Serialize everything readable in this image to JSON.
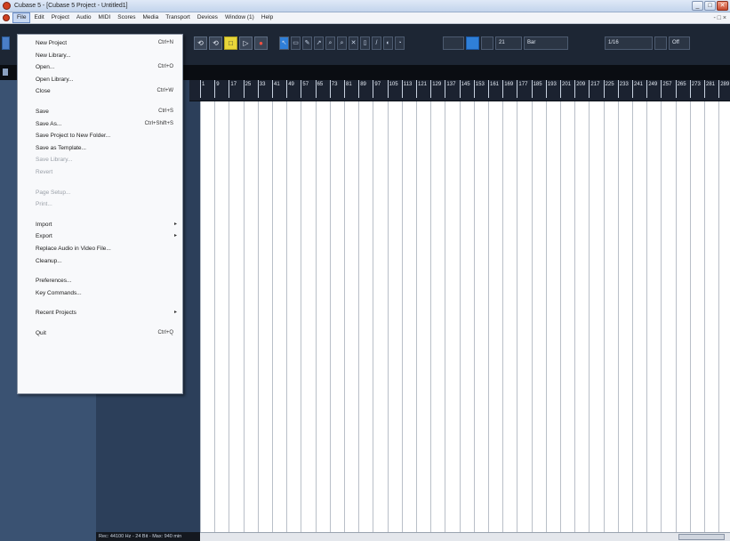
{
  "titlebar": {
    "title": "Cubase 5 - [Cubase 5 Project - Untitled1]",
    "minimize": "_",
    "maximize": "□",
    "close": "✕"
  },
  "menubar": {
    "items": [
      "File",
      "Edit",
      "Project",
      "Audio",
      "MIDI",
      "Scores",
      "Media",
      "Transport",
      "Devices",
      "Window (1)",
      "Help"
    ],
    "right": "- □ ×"
  },
  "toolbar": {
    "transport_buttons": [
      "⟲",
      "⟲",
      "□",
      "▷",
      "●"
    ],
    "tool_icons": [
      "↖",
      "▭",
      "✎",
      "↗",
      "⌕",
      "⌕",
      "✕",
      "▯",
      "/",
      "◐",
      "◔"
    ],
    "quantize_label": "Bar",
    "length_label": "1/16",
    "grid_label": "Off",
    "num_field": "21"
  },
  "ruler": {
    "marks": [
      "1",
      "9",
      "17",
      "25",
      "33",
      "41",
      "49",
      "57",
      "65",
      "73",
      "81",
      "89",
      "97",
      "105",
      "113",
      "121",
      "129",
      "137",
      "145",
      "153",
      "161",
      "169",
      "177",
      "185",
      "193",
      "201",
      "209",
      "217",
      "225",
      "233",
      "241",
      "249",
      "257",
      "265",
      "273",
      "281",
      "289"
    ]
  },
  "file_menu": {
    "items": [
      {
        "label": "New Project",
        "shortcut": "Ctrl+N"
      },
      {
        "label": "New Library..."
      },
      {
        "label": "Open...",
        "shortcut": "Ctrl+O"
      },
      {
        "label": "Open Library..."
      },
      {
        "label": "Close",
        "shortcut": "Ctrl+W"
      },
      {
        "sep": true
      },
      {
        "label": "Save",
        "shortcut": "Ctrl+S"
      },
      {
        "label": "Save As...",
        "shortcut": "Ctrl+Shift+S"
      },
      {
        "label": "Save Project to New Folder..."
      },
      {
        "label": "Save as Template..."
      },
      {
        "label": "Save Library...",
        "disabled": true
      },
      {
        "label": "Revert",
        "disabled": true
      },
      {
        "sep": true
      },
      {
        "label": "Page Setup...",
        "disabled": true
      },
      {
        "label": "Print...",
        "disabled": true
      },
      {
        "sep": true
      },
      {
        "label": "Import",
        "submenu": true
      },
      {
        "label": "Export",
        "submenu": true
      },
      {
        "label": "Replace Audio in Video File..."
      },
      {
        "label": "Cleanup..."
      },
      {
        "sep": true
      },
      {
        "label": "Preferences..."
      },
      {
        "label": "Key Commands..."
      },
      {
        "sep": true
      },
      {
        "label": "Recent Projects",
        "submenu": true
      },
      {
        "sep": true
      },
      {
        "label": "Quit",
        "shortcut": "Ctrl+Q"
      }
    ]
  },
  "statusbar": {
    "text": "Rec: 44100 Hz - 24 Bit - Max: 940 min"
  },
  "colors": {
    "toolbar_bg": "#1d2634",
    "panel_bg": "#3a5272",
    "event_bg": "#ffffff",
    "accent_yellow": "#e8d63a",
    "accent_blue": "#2f7fd8"
  }
}
